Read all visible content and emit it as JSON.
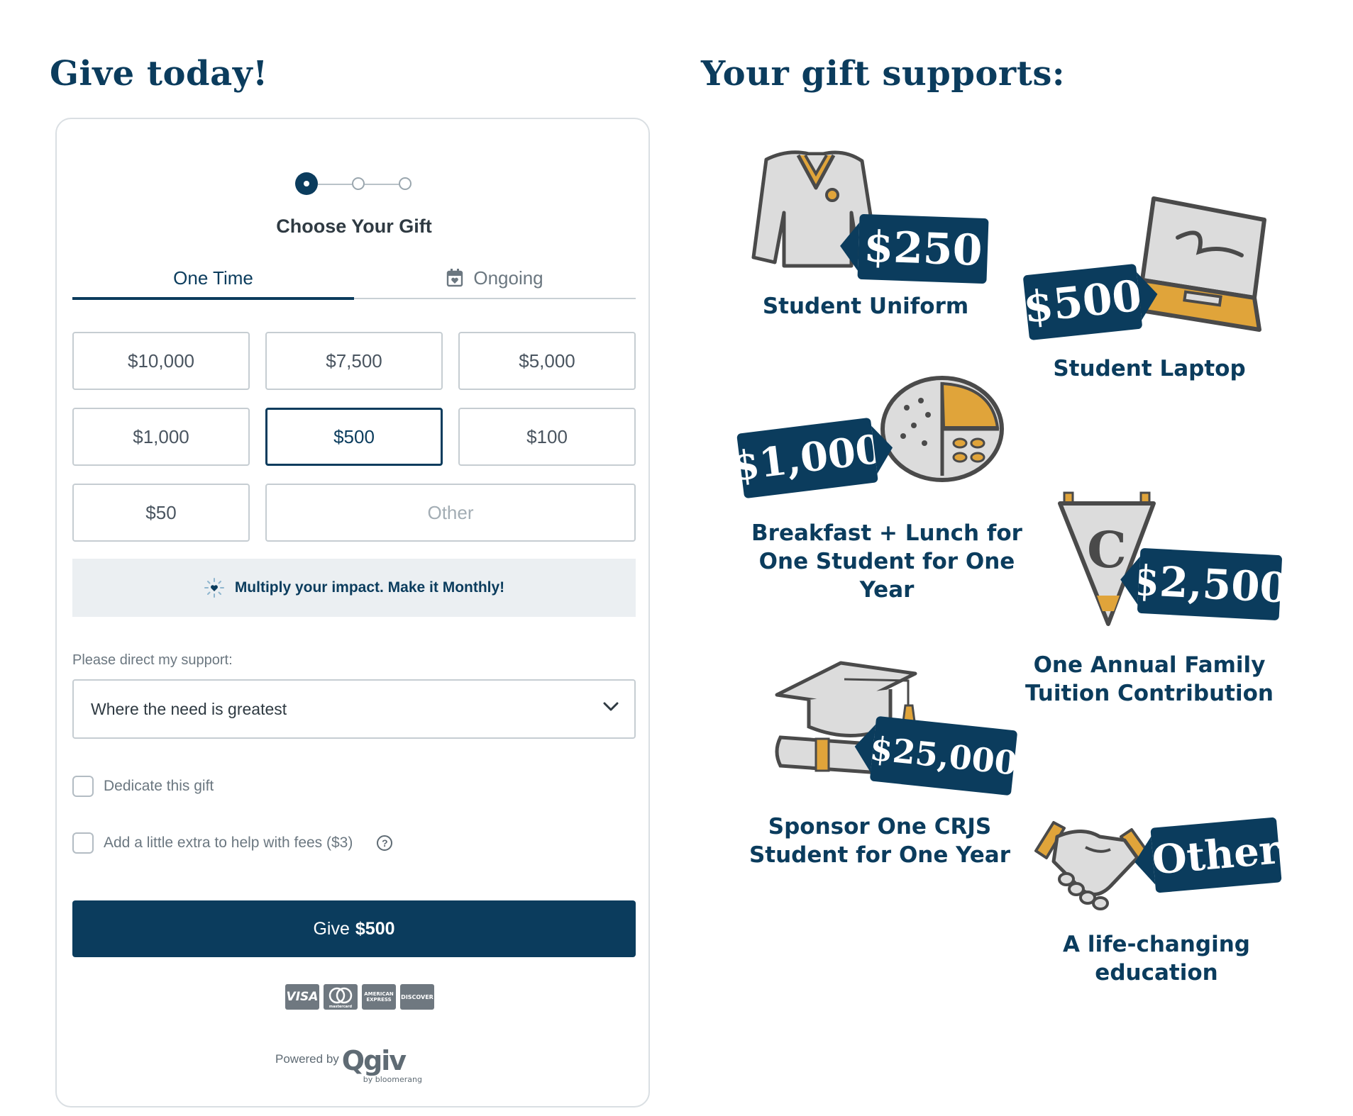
{
  "left_title": "Give today!",
  "right_title": "Your gift supports:",
  "form": {
    "step_title": "Choose Your Gift",
    "steps": 3,
    "active_step": 1,
    "tabs": {
      "one_time": "One Time",
      "ongoing": "Ongoing"
    },
    "amounts": [
      "$10,000",
      "$7,500",
      "$5,000",
      "$1,000",
      "$500",
      "$100",
      "$50"
    ],
    "selected_amount": "$500",
    "other_placeholder": "Other",
    "promo": "Multiply your impact. Make it Monthly!",
    "direct_label": "Please direct my support:",
    "direct_value": "Where the need is greatest",
    "dedicate_label": "Dedicate this gift",
    "fees_label": "Add a little extra to help with fees ($3)",
    "help_glyph": "?",
    "give_prefix": "Give",
    "give_amount": "$500",
    "card_logos": [
      "VISA",
      "mastercard",
      "AMERICAN EXPRESS",
      "DISCOVER"
    ],
    "powered_by": "Powered by",
    "brand": "Qgiv",
    "brand_sub": "by bloomerang"
  },
  "supports": [
    {
      "amount": "$250",
      "caption": [
        "Student Uniform"
      ],
      "icon": "sweater-icon"
    },
    {
      "amount": "$500",
      "caption": [
        "Student Laptop"
      ],
      "icon": "laptop-icon"
    },
    {
      "amount": "$1,000",
      "caption": [
        "Breakfast + Lunch for",
        "One Student for One Year"
      ],
      "icon": "lunch-tray-icon"
    },
    {
      "amount": "$2,500",
      "caption": [
        "One Annual Family",
        "Tuition Contribution"
      ],
      "icon": "pennant-icon",
      "pennant_letter": "C"
    },
    {
      "amount": "$25,000",
      "caption": [
        "Sponsor One CRJS",
        "Student for One Year"
      ],
      "icon": "graduation-cap-icon"
    },
    {
      "amount": "Other",
      "caption": [
        "A life-changing",
        "education"
      ],
      "icon": "handshake-icon"
    }
  ],
  "colors": {
    "navy": "#0b3c5d",
    "gold": "#e0a43a",
    "gray": "#d9d9d9",
    "outline": "#4a4a4a"
  }
}
